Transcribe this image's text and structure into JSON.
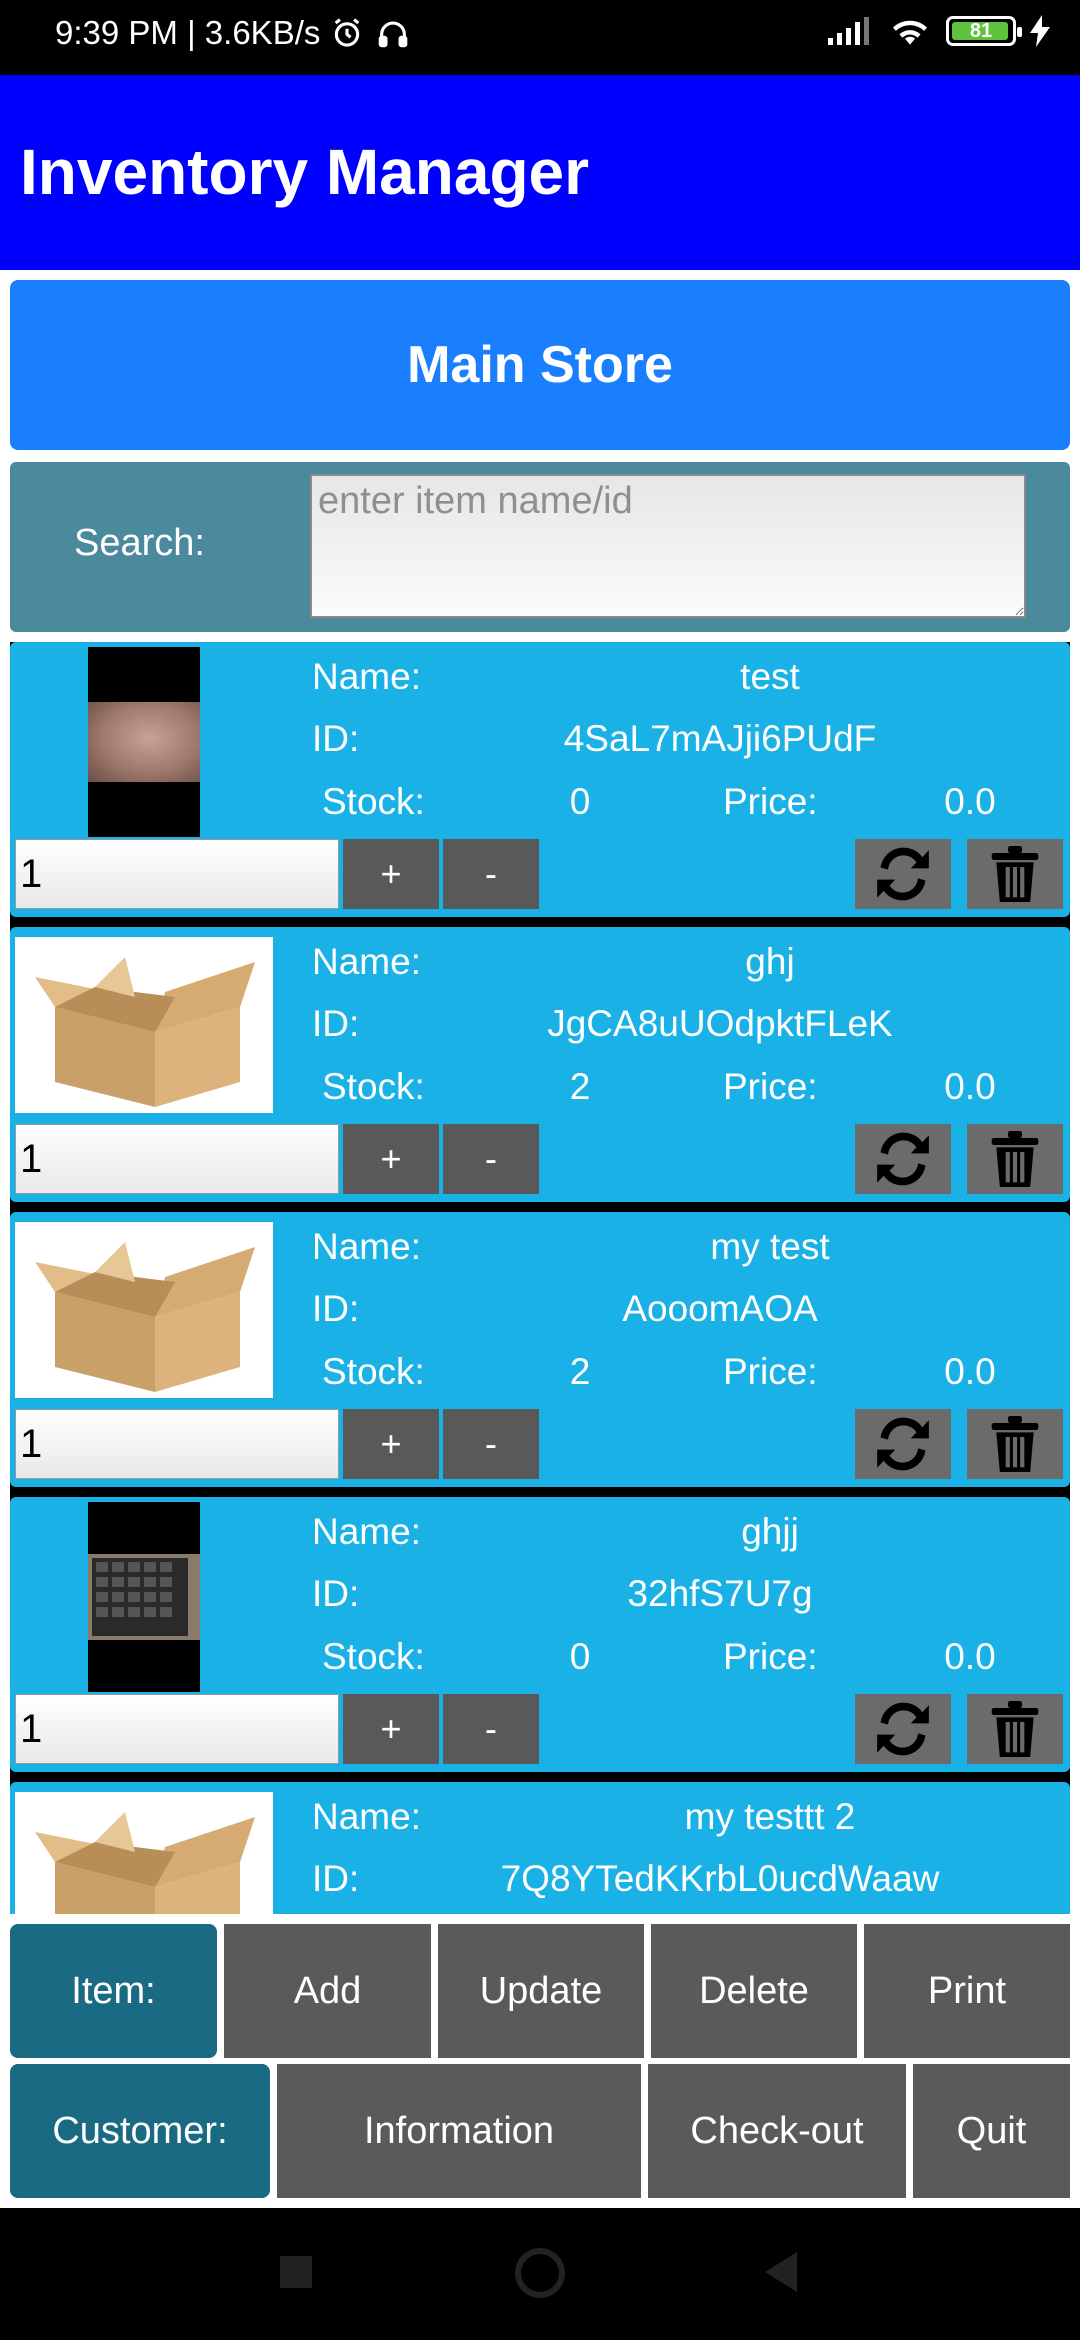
{
  "status_bar": {
    "time_net": "9:39 PM | 3.6KB/s",
    "battery": "81"
  },
  "app": {
    "title": "Inventory Manager",
    "store_name": "Main Store"
  },
  "search": {
    "label": "Search:",
    "placeholder": "enter item name/id"
  },
  "labels": {
    "name": "Name:",
    "id": "ID:",
    "stock": "Stock:",
    "price": "Price:"
  },
  "items": [
    {
      "name": "test",
      "id": "4SaL7mAJji6PUdF",
      "stock": "0",
      "price": "0.0",
      "qty": "1",
      "plus": "+",
      "minus": "-"
    },
    {
      "name": "ghj",
      "id": "JgCA8uUOdpktFLeK",
      "stock": "2",
      "price": "0.0",
      "qty": "1",
      "plus": "+",
      "minus": "-"
    },
    {
      "name": "my test",
      "id": "AooomAOA",
      "stock": "2",
      "price": "0.0",
      "qty": "1",
      "plus": "+",
      "minus": "-"
    },
    {
      "name": "ghjj",
      "id": "32hfS7U7g",
      "stock": "0",
      "price": "0.0",
      "qty": "1",
      "plus": "+",
      "minus": "-"
    },
    {
      "name": "my testtt 2",
      "id": "7Q8YTedKKrbL0ucdWaaw"
    }
  ],
  "item_bar": {
    "label": "Item:",
    "add": "Add",
    "update": "Update",
    "delete": "Delete",
    "print": "Print"
  },
  "customer_bar": {
    "label": "Customer:",
    "information": "Information",
    "checkout": "Check-out",
    "quit": "Quit"
  },
  "colors": {
    "app_bar": "#0000ff",
    "store_banner": "#1a7fff",
    "card": "#1ab2e6",
    "accent_button": "#196a82",
    "button": "#5a5a5a"
  }
}
